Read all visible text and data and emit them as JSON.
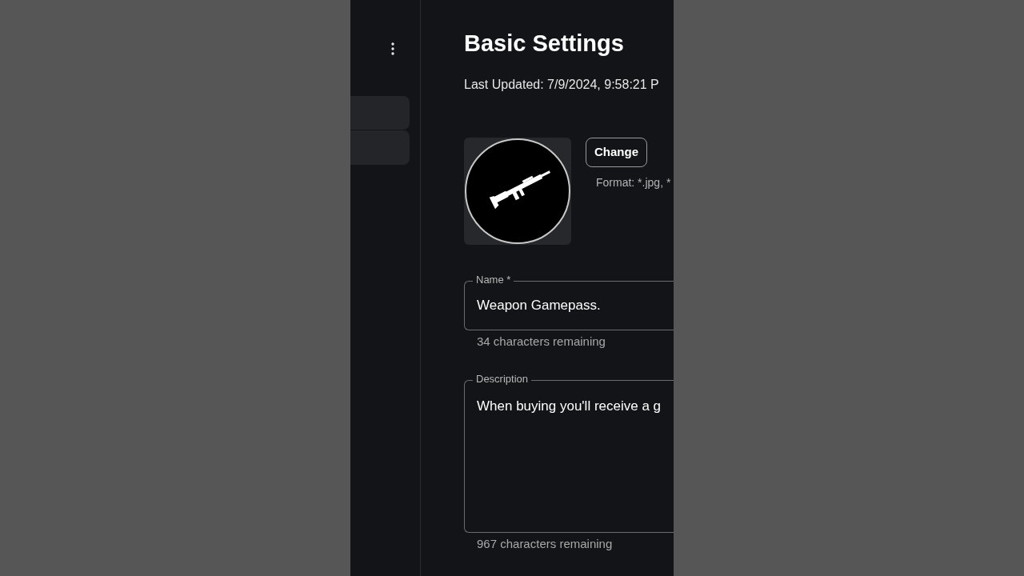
{
  "page": {
    "title": "Basic Settings",
    "last_updated": "Last Updated: 7/9/2024, 9:58:21 P"
  },
  "icon_upload": {
    "button": "Change",
    "format_hint": "Format: *.jpg, *"
  },
  "fields": [
    {
      "kind": "text",
      "label": "Name *",
      "value": "Weapon Gamepass.",
      "helper": "34 characters remaining"
    },
    {
      "kind": "textarea",
      "label": "Description",
      "value": "When buying you'll receive a g",
      "helper": "967 characters remaining"
    }
  ]
}
